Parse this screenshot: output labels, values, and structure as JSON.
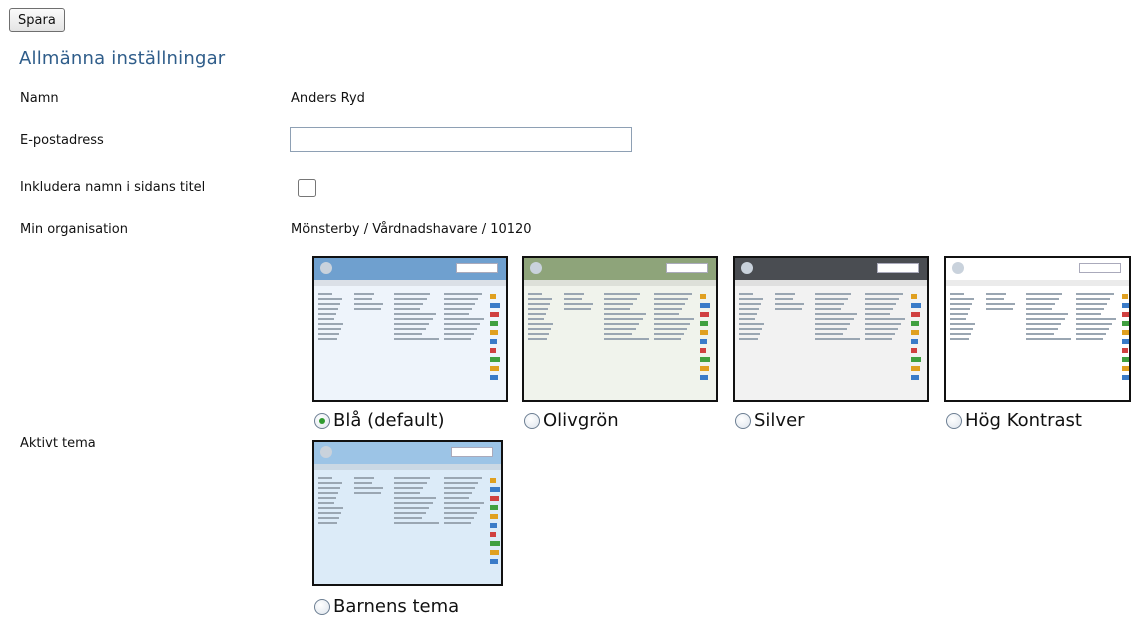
{
  "toolbar": {
    "save_label": "Spara"
  },
  "section": {
    "title": "Allmänna inställningar"
  },
  "rows": {
    "name_label": "Namn",
    "name_value": "Anders Ryd",
    "email_label": "E-postadress",
    "email_value": "",
    "include_name_label": "Inkludera namn i sidans titel",
    "include_name_checked": false,
    "org_label": "Min organisation",
    "org_value": "Mönsterby / Vårdnadshavare / 10120",
    "theme_label": "Aktivt tema"
  },
  "themes": [
    {
      "label": "Blå (default)",
      "selected": true,
      "header_color": "#6fa0cf",
      "bg_color": "#eef4fb"
    },
    {
      "label": "Olivgrön",
      "selected": false,
      "header_color": "#8ea47a",
      "bg_color": "#f0f3ec"
    },
    {
      "label": "Silver",
      "selected": false,
      "header_color": "#4a4d52",
      "bg_color": "#f2f2f2"
    },
    {
      "label": "Hög Kontrast",
      "selected": false,
      "header_color": "#ffffff",
      "bg_color": "#ffffff"
    },
    {
      "label": "Barnens tema",
      "selected": false,
      "header_color": "#9cc4e6",
      "bg_color": "#dcebf8"
    }
  ]
}
